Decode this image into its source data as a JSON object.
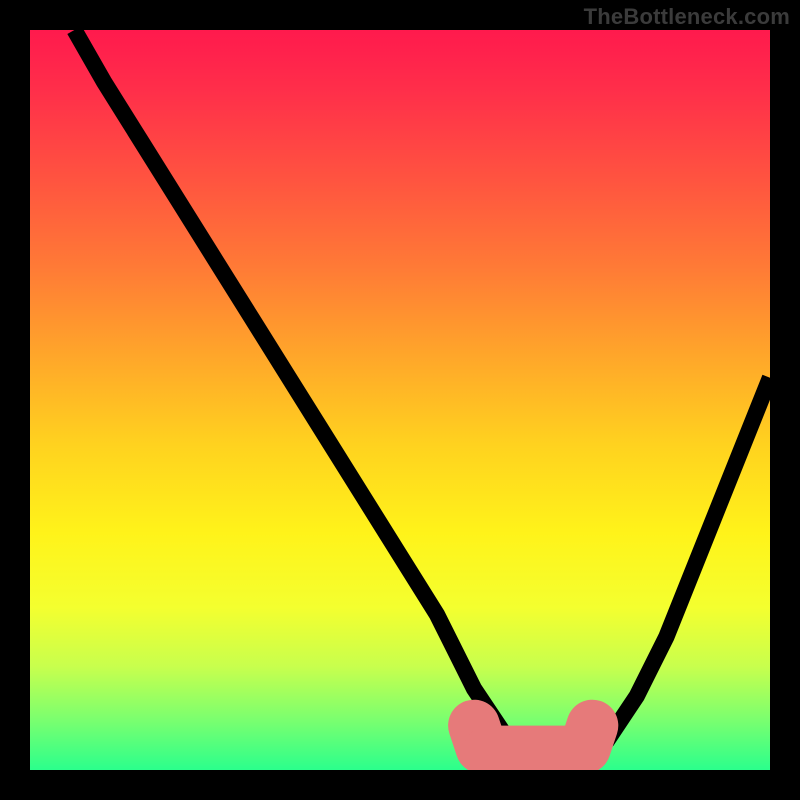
{
  "watermark": "TheBottleneck.com",
  "chart_data": {
    "type": "line",
    "title": "",
    "xlabel": "",
    "ylabel": "",
    "xlim": [
      0,
      100
    ],
    "ylim": [
      0,
      100
    ],
    "grid": false,
    "legend": false,
    "series": [
      {
        "name": "left-curve",
        "x": [
          6,
          10,
          15,
          20,
          25,
          30,
          35,
          40,
          45,
          50,
          55,
          58,
          60,
          62,
          64,
          66,
          68,
          70,
          72
        ],
        "y": [
          100,
          93,
          85,
          77,
          69,
          61,
          53,
          45,
          37,
          29,
          21,
          15,
          11,
          8,
          5,
          3,
          2,
          1,
          0
        ],
        "stroke": "#000000"
      },
      {
        "name": "right-curve",
        "x": [
          72,
          74,
          76,
          78,
          80,
          82,
          84,
          86,
          88,
          90,
          92,
          94,
          96,
          98,
          100
        ],
        "y": [
          0,
          1,
          2,
          4,
          7,
          10,
          14,
          18,
          23,
          28,
          33,
          38,
          43,
          48,
          53
        ],
        "stroke": "#000000"
      },
      {
        "name": "bottom-marker-left",
        "x": [
          60,
          61
        ],
        "y": [
          6,
          3
        ],
        "stroke": "#e67a7a"
      },
      {
        "name": "bottom-marker-flat",
        "x": [
          62,
          74
        ],
        "y": [
          2.5,
          2.5
        ],
        "stroke": "#e67a7a"
      },
      {
        "name": "bottom-marker-right",
        "x": [
          75,
          76
        ],
        "y": [
          3,
          6
        ],
        "stroke": "#e67a7a"
      }
    ],
    "background_gradient": {
      "direction": "vertical",
      "stops": [
        {
          "pos": 0.0,
          "color": "#ff1a4d"
        },
        {
          "pos": 0.2,
          "color": "#ff5340"
        },
        {
          "pos": 0.44,
          "color": "#ffa62a"
        },
        {
          "pos": 0.68,
          "color": "#fff31a"
        },
        {
          "pos": 0.86,
          "color": "#c8ff4d"
        },
        {
          "pos": 1.0,
          "color": "#2bff8c"
        }
      ]
    }
  }
}
